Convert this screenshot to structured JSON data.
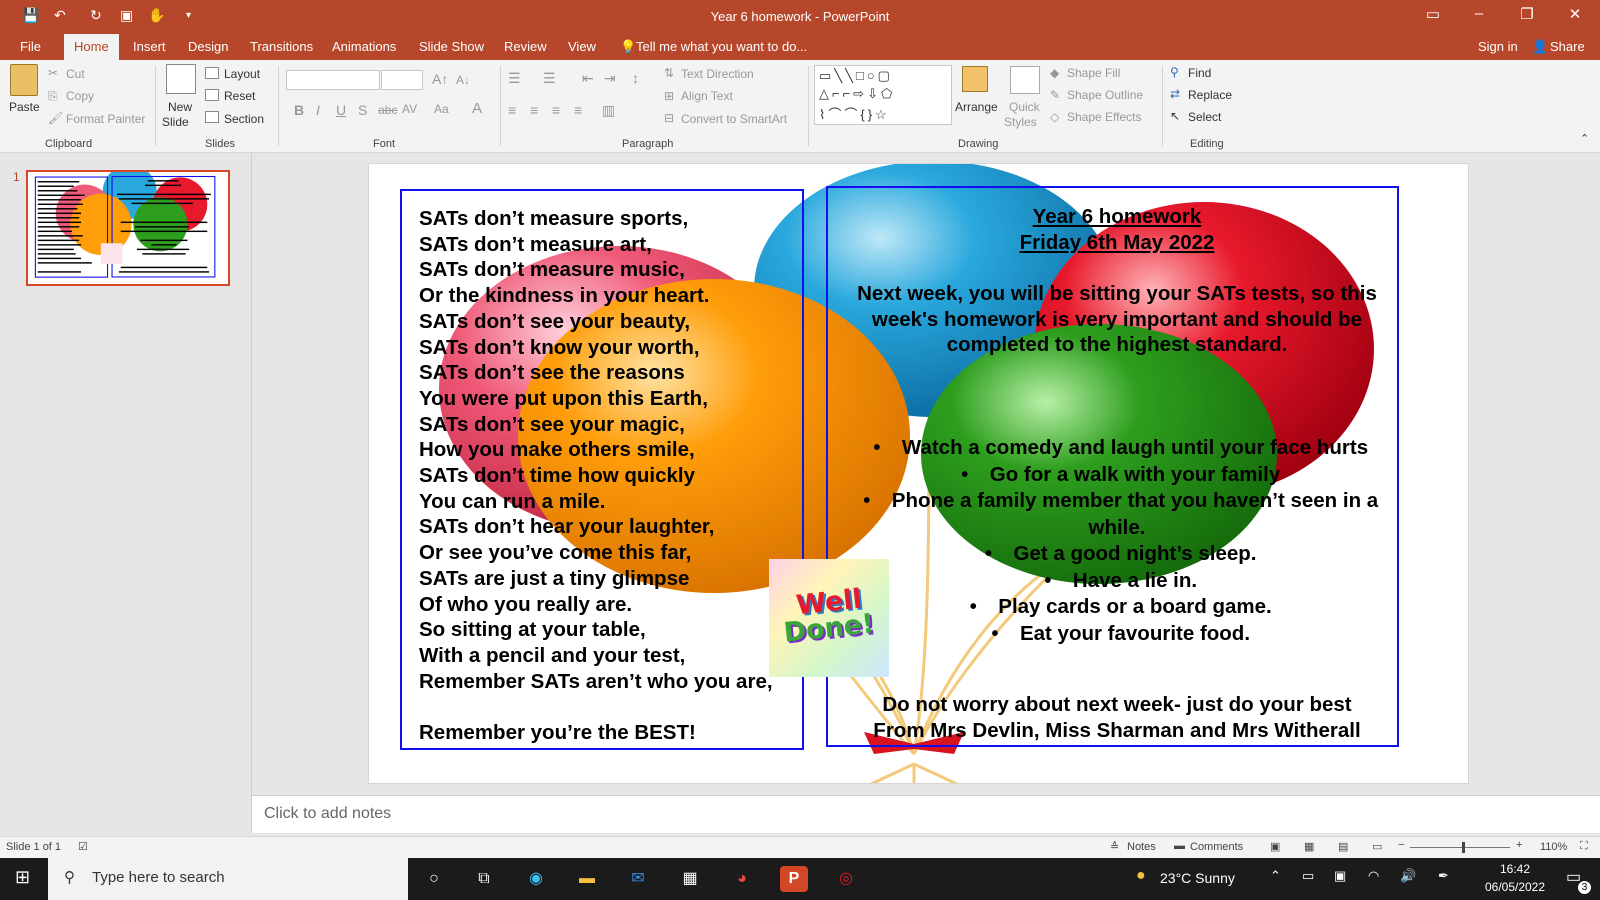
{
  "window": {
    "title": "Year 6 homework - PowerPoint"
  },
  "tabs": [
    "File",
    "Home",
    "Insert",
    "Design",
    "Transitions",
    "Animations",
    "Slide Show",
    "Review",
    "View"
  ],
  "tell_me": "Tell me what you want to do...",
  "sign_in": "Sign in",
  "share": "Share",
  "ribbon": {
    "clipboard": {
      "paste": "Paste",
      "cut": "Cut",
      "copy": "Copy",
      "format_painter": "Format Painter",
      "label": "Clipboard"
    },
    "slides": {
      "new_slide": "New",
      "new_slide_2": "Slide",
      "layout": "Layout",
      "reset": "Reset",
      "section": "Section",
      "label": "Slides"
    },
    "font": {
      "label": "Font"
    },
    "paragraph": {
      "text_direction": "Text Direction",
      "align_text": "Align Text",
      "convert_smartart": "Convert to SmartArt",
      "label": "Paragraph"
    },
    "drawing": {
      "arrange": "Arrange",
      "quick_styles_1": "Quick",
      "quick_styles_2": "Styles",
      "shape_fill": "Shape Fill",
      "shape_outline": "Shape Outline",
      "shape_effects": "Shape Effects",
      "label": "Drawing"
    },
    "editing": {
      "find": "Find",
      "replace": "Replace",
      "select": "Select",
      "label": "Editing"
    }
  },
  "thumbnail": {
    "number": "1"
  },
  "slide": {
    "poem": [
      "SATs don’t measure sports,",
      "SATs don’t measure art,",
      "SATs don’t measure music,",
      "Or the kindness in your heart.",
      "SATs don’t see your beauty,",
      "SATs don’t know your worth,",
      "SATs don’t see the reasons",
      "You were put upon this Earth,",
      "SATs don’t see your magic,",
      "How you make others smile,",
      "SATs don’t time how quickly",
      "You can run a mile.",
      "SATs don’t hear your laughter,",
      "Or see you’ve come this far,",
      "SATs are just a tiny glimpse",
      "Of who you really are.",
      "So sitting at your table,",
      "With a pencil and your test,",
      "Remember SATs aren’t who you are,"
    ],
    "poem_end": "Remember you’re the BEST!",
    "title1": "Year 6 homework",
    "title2": "Friday 6th May 2022",
    "intro": "Next week, you will be sitting your SATs tests, so this week's homework is very important and should be completed to the highest standard.",
    "tasks": [
      "Watch a comedy and laugh until your face hurts",
      "Go for a walk with your family",
      "Phone a family member that you haven’t seen in a while.",
      "Get a good night’s sleep.",
      "Have a lie in.",
      "Play cards or a board game.",
      "Eat your favourite food."
    ],
    "closing1": "Do not worry about next week- just do your best",
    "closing2": "From Mrs Devlin, Miss Sharman and Mrs Witherall",
    "sticker_text1": "Well",
    "sticker_text2": "Done!"
  },
  "notes_placeholder": "Click to add notes",
  "status": {
    "slide_info": "Slide 1 of 1",
    "notes": "Notes",
    "comments": "Comments",
    "zoom": "110%"
  },
  "taskbar": {
    "search_placeholder": "Type here to search",
    "weather": "23°C  Sunny",
    "time": "16:42",
    "date": "06/05/2022",
    "notification_count": "3"
  },
  "colors": {
    "accent": "#b7472a",
    "box_border": "#1010ee",
    "balloon_red": "#e8192c",
    "balloon_blue": "#2aa8dd",
    "balloon_orange": "#ff9d0a",
    "balloon_green": "#2e9e1e",
    "balloon_pink": "#ef5a78"
  }
}
